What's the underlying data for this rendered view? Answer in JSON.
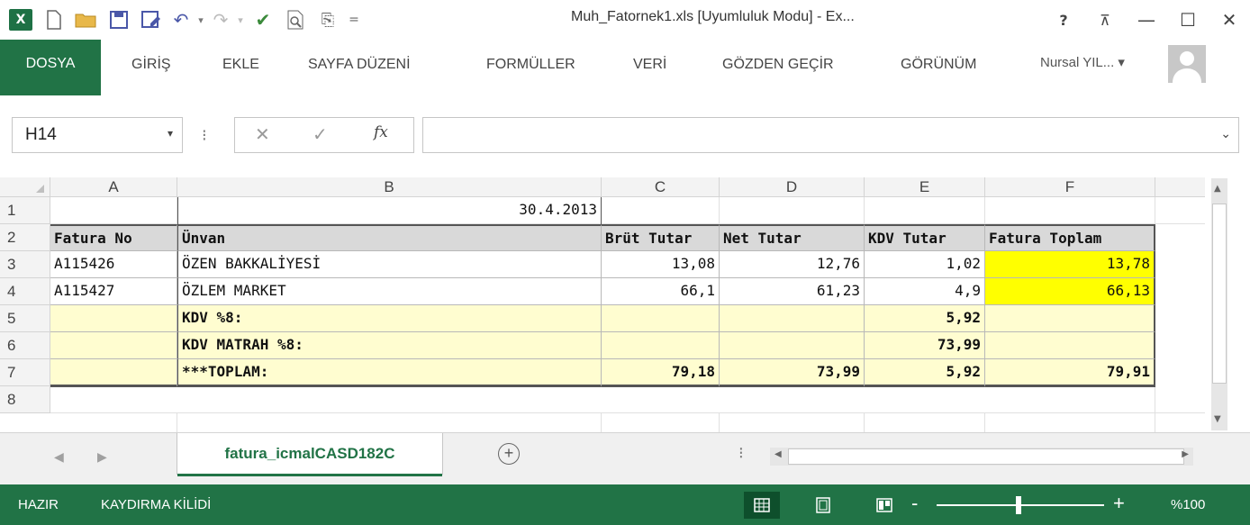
{
  "window": {
    "title": "Muh_Fatornek1.xls  [Uyumluluk Modu] - Ex...",
    "help": "?",
    "restore_ribbon": "⊼",
    "minimize": "—",
    "maximize": "☐",
    "close": "✕"
  },
  "quick_access": {
    "excel_logo": "X",
    "undo_arrow": "▾",
    "redo_arrow": "▾",
    "customize": "="
  },
  "ribbon": {
    "tabs": [
      "DOSYA",
      "GİRİŞ",
      "EKLE",
      "SAYFA DÜZENİ",
      "FORMÜLLER",
      "VERİ",
      "GÖZDEN GEÇİR",
      "GÖRÜNÜM"
    ],
    "user": "Nursal YIL...  ▾"
  },
  "formula_bar": {
    "name_box": "H14",
    "name_box_arrow": "▾",
    "separator": "⁝",
    "cancel": "✕",
    "enter": "✓",
    "fx": "fx",
    "formula": "",
    "expand": "⌄"
  },
  "columns": [
    "A",
    "B",
    "C",
    "D",
    "E",
    "F"
  ],
  "rows": [
    "1",
    "2",
    "3",
    "4",
    "5",
    "6",
    "7",
    "8"
  ],
  "sheet": {
    "b1": "30.4.2013",
    "headers": [
      "Fatura No",
      "Ünvan",
      "Brüt Tutar",
      "Net Tutar",
      "KDV Tutar",
      "Fatura Toplam"
    ],
    "row3": [
      "A115426",
      "ÖZEN BAKKALİYESİ",
      "13,08",
      "12,76",
      "1,02",
      "13,78"
    ],
    "row4": [
      "A115427",
      "ÖZLEM MARKET",
      "66,1",
      "61,23",
      "4,9",
      "66,13"
    ],
    "row5": {
      "label": "KDV %8:",
      "e": "5,92"
    },
    "row6": {
      "label": "KDV MATRAH %8:",
      "e": "73,99"
    },
    "row7": {
      "label": "***TOPLAM:",
      "c": "79,18",
      "d": "73,99",
      "e": "5,92",
      "f": "79,91"
    }
  },
  "sheet_tabs": {
    "active": "fatura_icmalCASD182C",
    "prev": "◀",
    "next": "▶",
    "add": "+",
    "dots": "⁝"
  },
  "status_bar": {
    "ready": "HAZIR",
    "scroll_lock": "KAYDIRMA KİLİDİ",
    "zoom_minus": "-",
    "zoom_plus": "+",
    "zoom": "%100"
  },
  "colors": {
    "excel_green": "#217346",
    "highlight_yellow": "#ffff00",
    "cream": "#fffdd0",
    "header_gray": "#d9d9d9"
  }
}
